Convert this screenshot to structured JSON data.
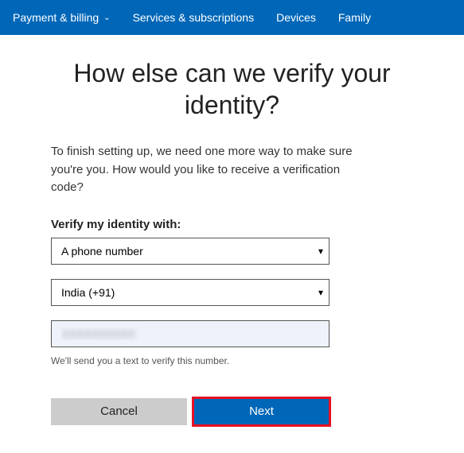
{
  "nav": {
    "items": [
      {
        "label": "Payment & billing",
        "has_dropdown": true
      },
      {
        "label": "Services & subscriptions",
        "has_dropdown": false
      },
      {
        "label": "Devices",
        "has_dropdown": false
      },
      {
        "label": "Family",
        "has_dropdown": false
      }
    ]
  },
  "heading": "How else can we verify your identity?",
  "description": "To finish setting up, we need one more way to make sure you're you. How would you like to receive a verification code?",
  "form": {
    "verify_label": "Verify my identity with:",
    "method_selected": "A phone number",
    "country_selected": "India (+91)",
    "phone_value": "XXXXXXXXXX",
    "note": "We'll send you a text to verify this number."
  },
  "buttons": {
    "cancel": "Cancel",
    "next": "Next"
  }
}
